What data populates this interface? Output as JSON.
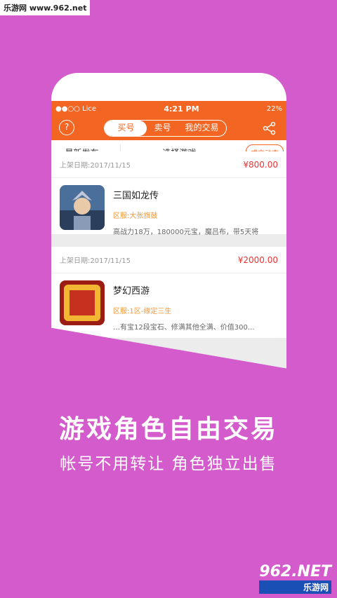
{
  "watermark_top": "乐游网 www.962.net",
  "status": {
    "carrier": "●●○○ Lice",
    "time": "4:21 PM",
    "battery": "22%"
  },
  "nav": {
    "help": "?",
    "tabs": [
      "买号",
      "卖号",
      "我的交易"
    ]
  },
  "filter": {
    "sort": "最新发布",
    "game": "选择游戏",
    "deals": "成交动态"
  },
  "listings": [
    {
      "date": "上架日期:2017/11/15",
      "price": "¥800.00",
      "title": "三国如龙传",
      "zone": "区服:大张旗鼓",
      "desc": "高战力18万，180000元宝，魔吕布，带5天将"
    },
    {
      "date": "上架日期:2017/11/15",
      "price": "¥2000.00",
      "title": "梦幻西游",
      "zone": "区服:1区-缘定三生",
      "desc": "…有宝12段宝石、修满其他全满、价值300…"
    }
  ],
  "headline": "游戏角色自由交易",
  "subheadline": "帐号不用转让 角色独立出售",
  "watermark_bottom": {
    "logo": "962.NET",
    "text": "乐游网"
  },
  "colors": {
    "bg": "#d45bcc",
    "accent": "#f26522",
    "price": "#e33333"
  }
}
